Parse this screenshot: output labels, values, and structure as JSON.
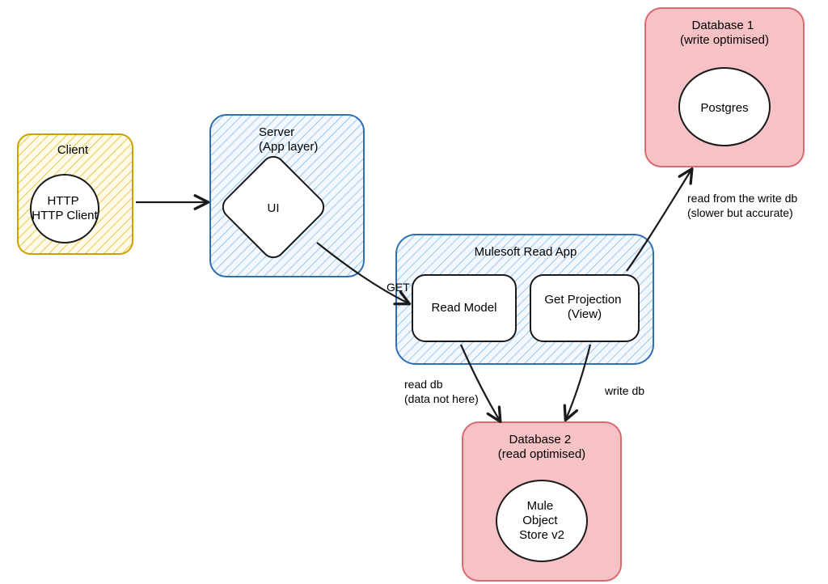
{
  "diagram": {
    "nodes": {
      "client": {
        "title": "Client",
        "item": "HTTP Client"
      },
      "server": {
        "title_line1": "Server",
        "title_line2": "(App layer)",
        "item": "UI"
      },
      "readApp": {
        "title": "Mulesoft Read App",
        "leftBox": "Read Model",
        "rightBox_line1": "Get Projection",
        "rightBox_line2": "(View)"
      },
      "db1": {
        "title_line1": "Database 1",
        "title_line2": "(write optimised)",
        "item": "Postgres"
      },
      "db2": {
        "title_line1": "Database 2",
        "title_line2": "(read optimised)",
        "item_line1": "Mule",
        "item_line2": "Object",
        "item_line3": "Store v2"
      }
    },
    "edges": {
      "clientToServer": "",
      "serverToReadApp": "GET",
      "readAppToDb1_line1": "read from the write db",
      "readAppToDb1_line2": "(slower but accurate)",
      "readModelToDb2_line1": "read db",
      "readModelToDb2_line2": "(data not here)",
      "projectionToDb2": "write db"
    },
    "colors": {
      "yellowFill": "#fff7d6",
      "yellowStroke": "#e0b400",
      "blueFill": "#e9f3fd",
      "blueStroke": "#2f6fb3",
      "pinkFill": "#f6c2c5",
      "pinkStroke": "#d86a72",
      "ink": "#1a1a1a"
    }
  }
}
